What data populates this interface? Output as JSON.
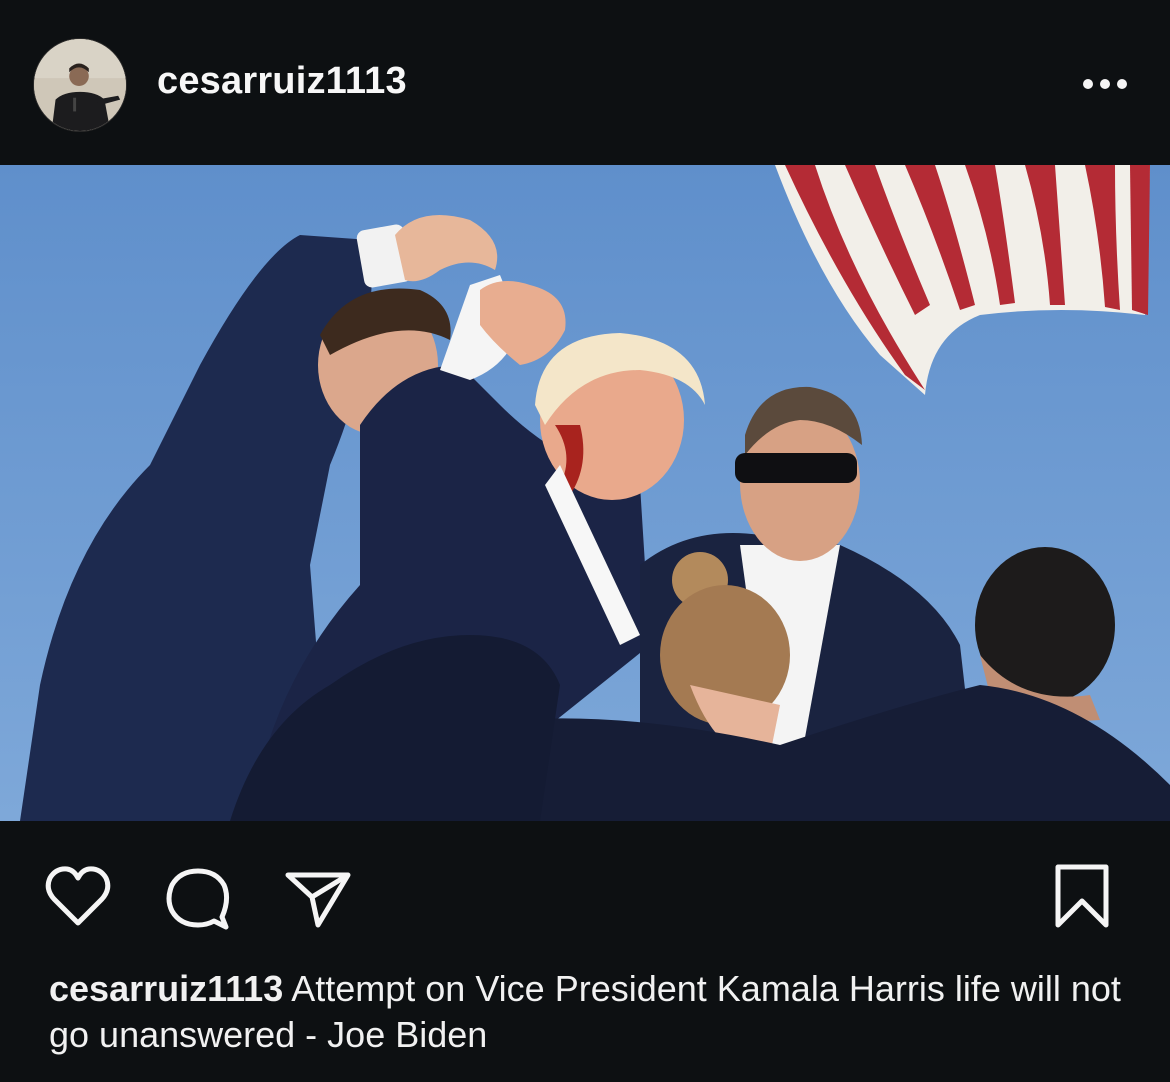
{
  "post": {
    "username": "cesarruiz1113",
    "caption_username": "cesarruiz1113",
    "caption_text": "Attempt on Vice President Kamala Harris life will not go unanswered - Joe Biden"
  },
  "icons": {
    "avatar": "profile-photo",
    "more": "more-dots-icon",
    "like": "heart-icon",
    "comment": "comment-bubble-icon",
    "share": "paper-plane-icon",
    "save": "bookmark-icon"
  },
  "colors": {
    "background": "#0d1012",
    "text": "#f5f5f5",
    "sky": "#6e99cf"
  }
}
